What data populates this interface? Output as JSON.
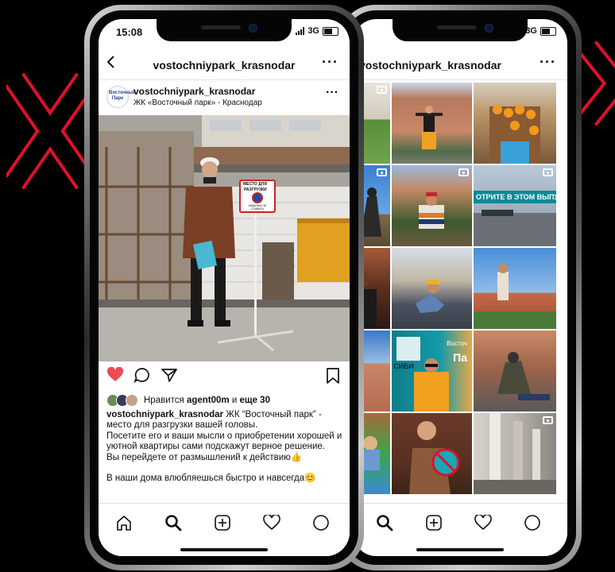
{
  "left_phone": {
    "status": {
      "time": "15:08",
      "network": "3G"
    },
    "navbar": {
      "back_icon": "chevron-left-icon",
      "title": "vostochniypark_krasnodar",
      "more_icon": "more-horizontal-icon"
    },
    "post": {
      "avatar_text": "Восточный Парк",
      "username": "vostochniypark_krasnodar",
      "location": "ЖК «Восточный парк» - Краснодар",
      "sign_text": [
        "МЕСТО ДЛЯ",
        "РАЗГРУЗКИ",
        "МАШИНЫ НЕ СТАВИТЬ"
      ],
      "likes_prefix": "Нравится",
      "likes_user": "agent00m",
      "likes_mid": "и",
      "likes_rest": "еще 30",
      "caption_user": "vostochniypark_krasnodar",
      "caption_text": "ЖК “Восточный парк” - место для разгрузки вашей головы.",
      "caption_line2": "Посетите его и ваши мысли о приобретении хорошей и уютной квартиры сами подскажут верное решение.",
      "caption_line3": "Вы перейдете от размышлений к действию👍",
      "caption_line4": "В наши дома влюбляешься быстро и навсегда😊"
    },
    "actions": [
      "heart-icon",
      "comment-icon",
      "share-icon",
      "bookmark-icon"
    ],
    "tabbar": [
      "home-icon",
      "search-icon",
      "add-icon",
      "activity-icon",
      "profile-icon"
    ]
  },
  "right_phone": {
    "status": {
      "network": "3G"
    },
    "navbar": {
      "title": "vostochniypark_krasnodar",
      "more_icon": "more-horizontal-icon"
    },
    "grid_banner_text": "ОТРИТЕ В ЭТОМ ВЫПУСК",
    "grid_sign_text": [
      "СИБИ",
      "Восточ",
      "Па"
    ],
    "tabbar": [
      "search-icon",
      "add-icon",
      "activity-icon",
      "profile-icon"
    ]
  },
  "colors": {
    "accent_red": "#e0102a",
    "like_red": "#ed4956",
    "teal": "#0a8a96"
  }
}
